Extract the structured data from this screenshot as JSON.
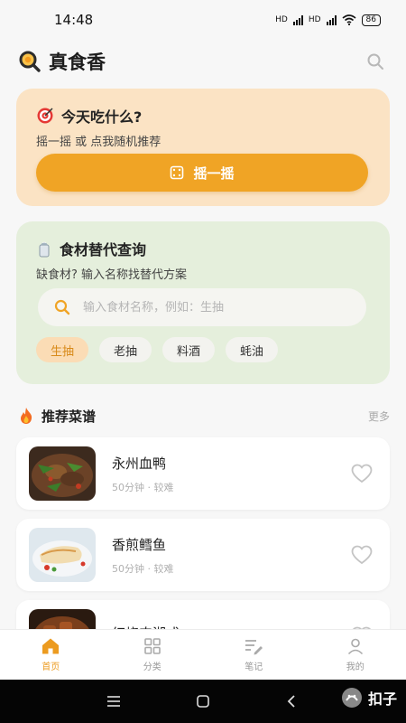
{
  "status_bar": {
    "time": "14:48",
    "signal1": "HD",
    "signal2": "HD",
    "battery": "86"
  },
  "header": {
    "app_title": "真食香"
  },
  "random_card": {
    "title": "今天吃什么?",
    "subtitle": "摇一摇 或 点我随机推荐",
    "button_label": "摇一摇"
  },
  "substitute_card": {
    "title": "食材替代查询",
    "subtitle": "缺食材? 输入名称找替代方案",
    "search_placeholder": "输入食材名称，例如：生抽",
    "chips": [
      "生抽",
      "老抽",
      "料酒",
      "蚝油"
    ]
  },
  "recommend": {
    "title": "推荐菜谱",
    "more": "更多",
    "recipes": [
      {
        "name": "永州血鸭",
        "meta": "50分钟 · 较难"
      },
      {
        "name": "香煎鳕鱼",
        "meta": "50分钟 · 较难"
      },
      {
        "name": "红烧肉湘式",
        "meta": ""
      }
    ]
  },
  "tabs": [
    "首页",
    "分类",
    "笔记",
    "我的"
  ],
  "watermark": "扣子",
  "colors": {
    "accent": "#f0a425",
    "random_card_bg": "#fbe3c4",
    "substitute_card_bg": "#e5efdc"
  }
}
